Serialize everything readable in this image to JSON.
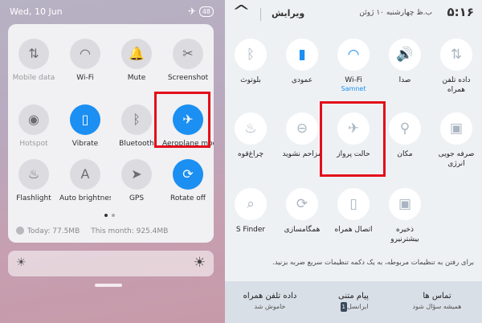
{
  "left": {
    "status": {
      "time": "Wed, 10 Jun",
      "battery": "48"
    },
    "tiles": [
      {
        "label": "Mobile data",
        "icon": "mobile-data-icon",
        "glyph": "⇅",
        "active": false,
        "dim": true
      },
      {
        "label": "Wi-Fi",
        "icon": "wifi-icon",
        "glyph": "◠",
        "active": false,
        "dim": false
      },
      {
        "label": "Mute",
        "icon": "bell-icon",
        "glyph": "🔔",
        "active": false,
        "dim": false
      },
      {
        "label": "Screenshot",
        "icon": "screenshot-icon",
        "glyph": "✂",
        "active": false,
        "dim": false
      },
      {
        "label": "Hotspot",
        "icon": "hotspot-icon",
        "glyph": "◉",
        "active": false,
        "dim": true
      },
      {
        "label": "Vibrate",
        "icon": "vibrate-icon",
        "glyph": "▯",
        "active": true,
        "dim": false
      },
      {
        "label": "Bluetooth",
        "icon": "bluetooth-icon",
        "glyph": "ᛒ",
        "active": false,
        "dim": false
      },
      {
        "label": "Aeroplane mode",
        "icon": "airplane-icon",
        "glyph": "✈",
        "active": true,
        "dim": false
      },
      {
        "label": "Flashlight",
        "icon": "flashlight-icon",
        "glyph": "♨",
        "active": false,
        "dim": false
      },
      {
        "label": "Auto brightness",
        "icon": "auto-brightness-icon",
        "glyph": "A",
        "active": false,
        "dim": false
      },
      {
        "label": "GPS",
        "icon": "gps-icon",
        "glyph": "➤",
        "active": false,
        "dim": false
      },
      {
        "label": "Rotate off",
        "icon": "rotate-lock-icon",
        "glyph": "⟳",
        "active": true,
        "dim": false
      }
    ],
    "usage": {
      "today": "Today: 77.5MB",
      "month": "This month: 925.4MB"
    }
  },
  "right": {
    "header": {
      "edit": "ویرایش",
      "date": "چهارشنبه ۱۰ ژوئن",
      "clock": "۵:۱۶",
      "ampm": "ب.ظ"
    },
    "tiles": [
      {
        "label": "بلوتوث",
        "sub": "",
        "icon": "bluetooth-icon",
        "glyph": "ᛒ",
        "active": false
      },
      {
        "label": "عمودی",
        "sub": "",
        "icon": "portrait-lock-icon",
        "glyph": "▮",
        "active": true
      },
      {
        "label": "Wi-Fi",
        "sub": "Samnet",
        "icon": "wifi-icon",
        "glyph": "◠",
        "active": true
      },
      {
        "label": "صدا",
        "sub": "",
        "icon": "sound-icon",
        "glyph": "🔊",
        "active": true
      },
      {
        "label": "داده تلفن همراه",
        "sub": "",
        "icon": "mobile-data-icon",
        "glyph": "⇅",
        "active": false
      },
      {
        "label": "چراغ‌قوه",
        "sub": "",
        "icon": "flashlight-icon",
        "glyph": "♨",
        "active": false
      },
      {
        "label": "مزاحم نشوید",
        "sub": "",
        "icon": "do-not-disturb-icon",
        "glyph": "⊖",
        "active": false
      },
      {
        "label": "حالت پرواز",
        "sub": "",
        "icon": "airplane-icon",
        "glyph": "✈",
        "active": false
      },
      {
        "label": "مکان",
        "sub": "",
        "icon": "location-icon",
        "glyph": "⚲",
        "active": false
      },
      {
        "label": "صرفه جویی انرژی",
        "sub": "",
        "icon": "power-saving-icon",
        "glyph": "▣",
        "active": false
      },
      {
        "label": "S Finder",
        "sub": "",
        "icon": "search-icon",
        "glyph": "⌕",
        "active": false
      },
      {
        "label": "همگامسازی",
        "sub": "",
        "icon": "sync-icon",
        "glyph": "⟳",
        "active": false
      },
      {
        "label": "اتصال همراه",
        "sub": "",
        "icon": "mobile-connect-icon",
        "glyph": "▯",
        "active": false
      },
      {
        "label": "ذخیره بیشترنیرو",
        "sub": "",
        "icon": "ultra-power-saving-icon",
        "glyph": "▣",
        "active": false
      }
    ],
    "hint": "برای رفتن به تنظیمات مربوطه، به یک دکمه تنظیمات سریع ضربه بزنید.",
    "bottom": [
      {
        "title": "داده تلفن همراه",
        "sub": "خاموش شد",
        "num": ""
      },
      {
        "title": "پیام متنی",
        "sub": "ایرانسل",
        "num": "1"
      },
      {
        "title": "تماس ها",
        "sub": "همیشه سؤال شود",
        "num": ""
      }
    ]
  }
}
